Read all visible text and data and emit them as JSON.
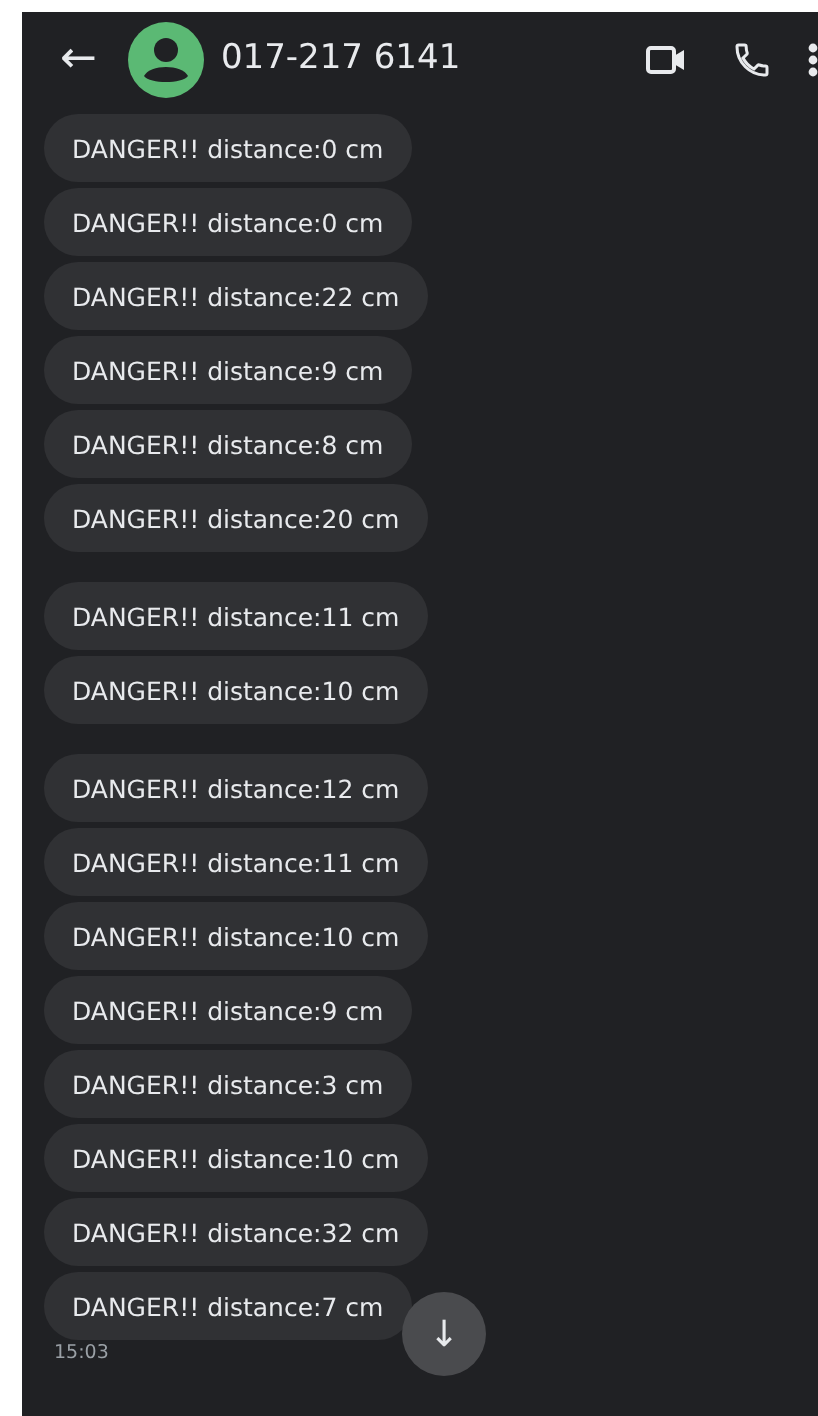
{
  "header": {
    "back": "←",
    "contact": "017-217 6141"
  },
  "groups": [
    {
      "messages": [
        "DANGER!! distance:0 cm",
        "DANGER!! distance:0 cm",
        "DANGER!! distance:22 cm",
        "DANGER!! distance:9 cm",
        "DANGER!! distance:8 cm",
        "DANGER!! distance:20 cm"
      ]
    },
    {
      "messages": [
        "DANGER!! distance:11 cm",
        "DANGER!! distance:10 cm"
      ]
    },
    {
      "messages": [
        "DANGER!! distance:12 cm",
        "DANGER!! distance:11 cm",
        "DANGER!! distance:10 cm",
        "DANGER!! distance:9 cm",
        "DANGER!! distance:3 cm",
        "DANGER!! distance:10 cm",
        "DANGER!! distance:32 cm",
        "DANGER!! distance:7 cm"
      ]
    }
  ],
  "timestamp": "15:03",
  "scroll_button": "↓"
}
